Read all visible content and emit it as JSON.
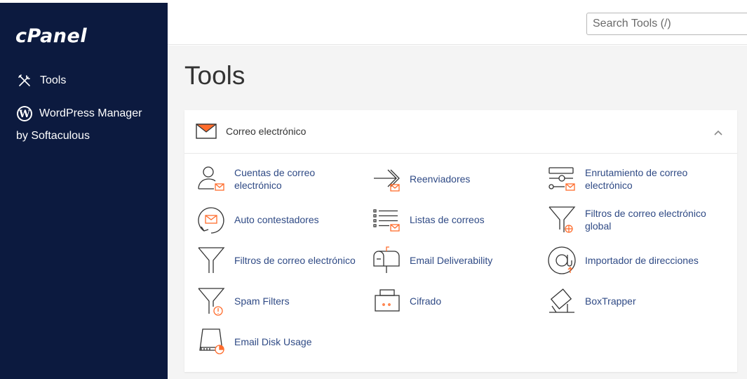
{
  "sidebar": {
    "logo": "cPanel",
    "items": [
      {
        "label": "Tools",
        "icon": "tools-icon"
      },
      {
        "label_line1": "WordPress Manager",
        "label_line2": "by Softaculous",
        "icon": "wordpress-icon"
      }
    ]
  },
  "search": {
    "placeholder": "Search Tools (/)"
  },
  "page": {
    "title": "Tools"
  },
  "section": {
    "title": "Correo electrónico",
    "icon": "envelope-icon",
    "accent": "#ff6c2c",
    "tools": [
      {
        "line1": "Cuentas de correo",
        "line2": "electrónico",
        "icon": "email-accounts-icon"
      },
      {
        "line1": "Reenviadores",
        "line2": "",
        "icon": "forwarders-icon"
      },
      {
        "line1": "Enrutamiento de correo",
        "line2": "electrónico",
        "icon": "email-routing-icon"
      },
      {
        "line1": "Auto contestadores",
        "line2": "",
        "icon": "autoresponders-icon"
      },
      {
        "line1": "Listas de correos",
        "line2": "",
        "icon": "mailing-lists-icon"
      },
      {
        "line1": "Filtros de correo electrónico",
        "line2": "global",
        "icon": "global-filters-icon"
      },
      {
        "line1": "Filtros de correo electrónico",
        "line2": "",
        "icon": "email-filters-icon"
      },
      {
        "line1": "Email Deliverability",
        "line2": "",
        "icon": "mailbox-icon"
      },
      {
        "line1": "Importador de direcciones",
        "line2": "",
        "icon": "address-importer-icon"
      },
      {
        "line1": "Spam Filters",
        "line2": "",
        "icon": "spam-filters-icon"
      },
      {
        "line1": "Cifrado",
        "line2": "",
        "icon": "encryption-icon"
      },
      {
        "line1": "BoxTrapper",
        "line2": "",
        "icon": "boxtrapper-icon"
      },
      {
        "line1": "Email Disk Usage",
        "line2": "",
        "icon": "disk-usage-icon"
      }
    ]
  }
}
